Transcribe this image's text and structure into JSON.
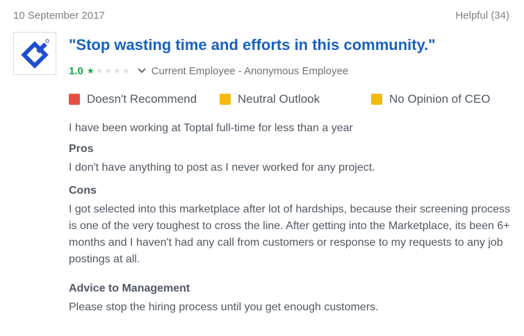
{
  "review": {
    "date": "10 September 2017",
    "helpful": "Helpful (34)",
    "title": "\"Stop wasting time and efforts in this community.\"",
    "rating": "1.0",
    "rating_stars": 1,
    "rating_max": 5,
    "employee": "Current Employee - Anonymous Employee",
    "outlooks": [
      {
        "label": "Doesn't Recommend",
        "color": "#e64e42"
      },
      {
        "label": "Neutral Outlook",
        "color": "#f5b914"
      },
      {
        "label": "No Opinion of CEO",
        "color": "#f5b914"
      }
    ],
    "tenure": "I have been working at Toptal full-time for less than a year",
    "pros_heading": "Pros",
    "pros_text": "I don't have anything to post as I never worked for any project.",
    "cons_heading": "Cons",
    "cons_text": "I got selected into this marketplace after lot of hardships, because their screening process is one of the very toughest to cross the line. After getting into the Marketplace, its been 6+ months and I haven't had any call from customers or response to my requests to any job postings at all.",
    "advice_heading": "Advice to Management",
    "advice_text": "Please stop the hiring process until you get enough customers."
  },
  "company": {
    "logo_icon": "toptal-logo-icon",
    "logo_color": "#204ecf"
  }
}
